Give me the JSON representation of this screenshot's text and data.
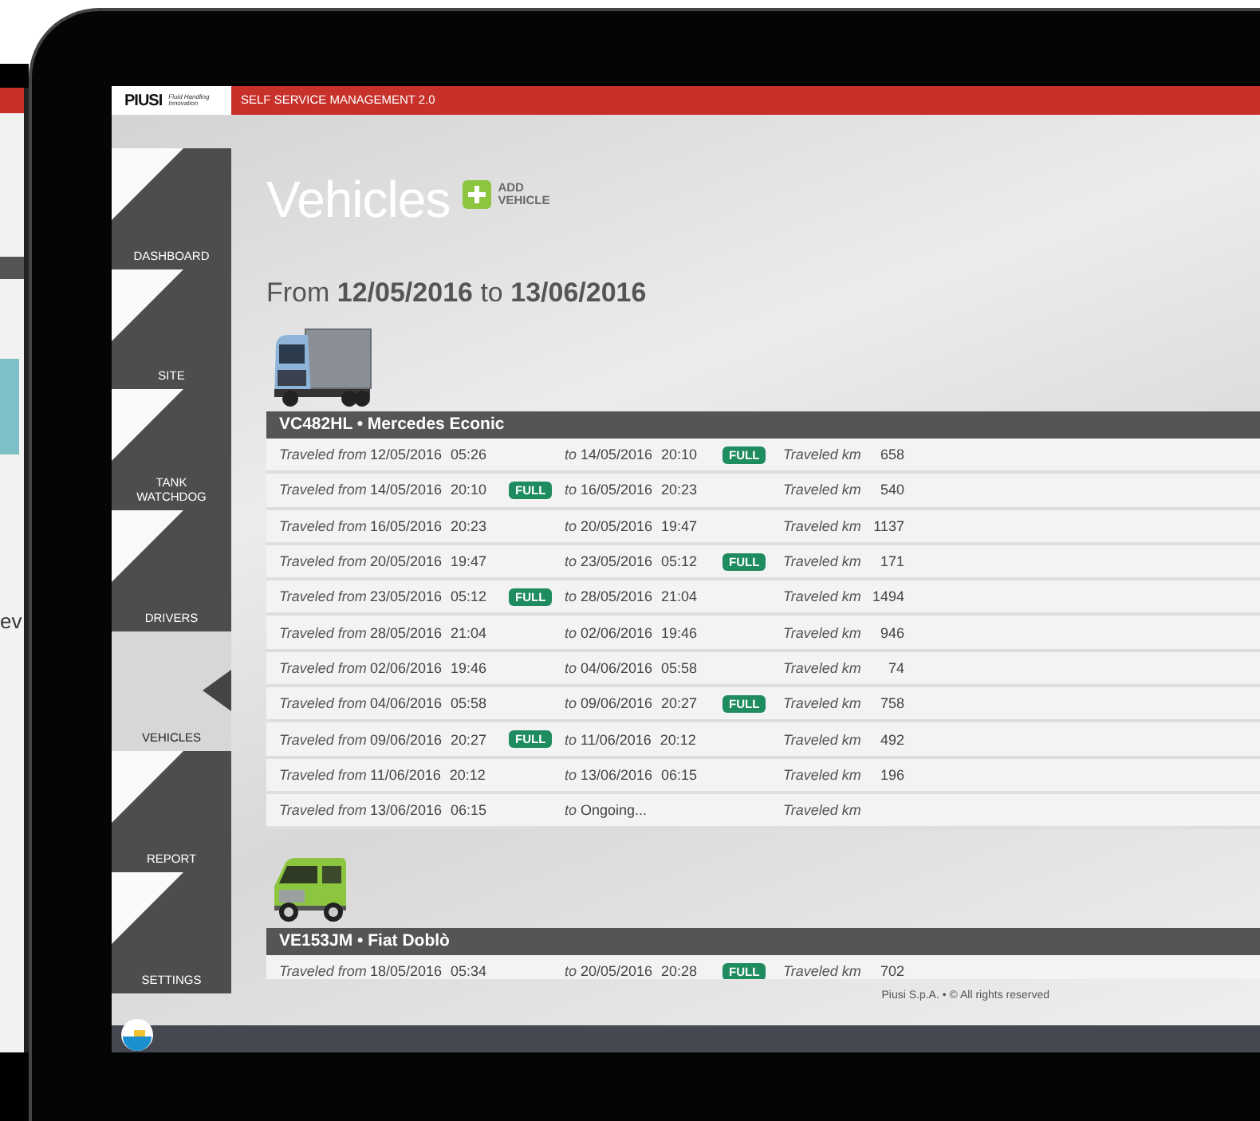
{
  "device_back": {
    "text": "ev"
  },
  "header": {
    "logo": "PIUSI",
    "tagline": "Fluid Handling Innovation",
    "title": "SELF SERVICE MANAGEMENT 2.0"
  },
  "nav": [
    {
      "label": "DASHBOARD",
      "selected": false
    },
    {
      "label": "SITE",
      "selected": false
    },
    {
      "label": "TANK WATCHDOG",
      "selected": false
    },
    {
      "label": "DRIVERS",
      "selected": false
    },
    {
      "label": "VEHICLES",
      "selected": true
    },
    {
      "label": "REPORT",
      "selected": false
    },
    {
      "label": "SETTINGS",
      "selected": false
    }
  ],
  "page": {
    "title": "Vehicles",
    "add_button": "ADD VEHICLE",
    "range": "From **12/05/2016** to **13/06/2016**"
  },
  "vehicles": [
    {
      "kind": "truck",
      "heading": "VC482HL • Mercedes Econic",
      "trips": [
        {
          "from_label": "Traveled from",
          "from": "12/05/2016 05:26",
          "to_label": "to",
          "to": "14/05/2016 20:10",
          "end_badge": "FULL",
          "km_label": "Traveled km",
          "km": "658"
        },
        {
          "from_label": "Traveled from",
          "from": "14/05/2016 20:10",
          "start_badge": "FULL",
          "to_label": "to",
          "to": "16/05/2016 20:23",
          "km_label": "Traveled km",
          "km": "540"
        },
        {
          "from_label": "Traveled from",
          "from": "16/05/2016 20:23",
          "to_label": "to",
          "to": "20/05/2016 19:47",
          "km_label": "Traveled km",
          "km": "1137"
        },
        {
          "from_label": "Traveled from",
          "from": "20/05/2016 19:47",
          "to_label": "to",
          "to": "23/05/2016 05:12",
          "end_badge": "FULL",
          "km_label": "Traveled km",
          "km": "171"
        },
        {
          "from_label": "Traveled from",
          "from": "23/05/2016 05:12",
          "start_badge": "FULL",
          "to_label": "to",
          "to": "28/05/2016 21:04",
          "km_label": "Traveled km",
          "km": "1494"
        },
        {
          "from_label": "Traveled from",
          "from": "28/05/2016 21:04",
          "to_label": "to",
          "to": "02/06/2016 19:46",
          "km_label": "Traveled km",
          "km": "946"
        },
        {
          "from_label": "Traveled from",
          "from": "02/06/2016 19:46",
          "to_label": "to",
          "to": "04/06/2016 05:58",
          "km_label": "Traveled km",
          "km": "74"
        },
        {
          "from_label": "Traveled from",
          "from": "04/06/2016 05:58",
          "to_label": "to",
          "to": "09/06/2016 20:27",
          "end_badge": "FULL",
          "km_label": "Traveled km",
          "km": "758"
        },
        {
          "from_label": "Traveled from",
          "from": "09/06/2016 20:27",
          "start_badge": "FULL",
          "to_label": "to",
          "to": "11/06/2016 20:12",
          "km_label": "Traveled km",
          "km": "492"
        },
        {
          "from_label": "Traveled from",
          "from": "11/06/2016 20:12",
          "to_label": "to",
          "to": "13/06/2016 06:15",
          "km_label": "Traveled km",
          "km": "196"
        },
        {
          "from_label": "Traveled from",
          "from": "13/06/2016 06:15",
          "to_label": "to",
          "to": "Ongoing...",
          "km_label": "Traveled km"
        }
      ]
    },
    {
      "kind": "van",
      "heading": "VE153JM • Fiat Doblò",
      "trips": [
        {
          "from_label": "Traveled from",
          "from": "18/05/2016 05:34",
          "to_label": "to",
          "to": "20/05/2016 20:28",
          "end_badge": "FULL",
          "km_label": "Traveled km",
          "km": "702"
        }
      ]
    }
  ],
  "footer": "Piusi S.p.A. • © All rights reserved"
}
